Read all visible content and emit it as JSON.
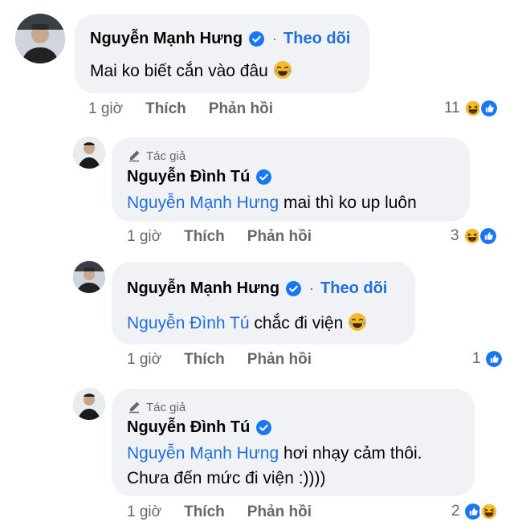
{
  "comments": [
    {
      "author": "Nguyễn Mạnh Hưng",
      "follow": "Theo dõi",
      "text": "Mai ko biết cắn vào đâu",
      "time": "1 giờ",
      "like": "Thích",
      "reply": "Phản hồi",
      "reaction_count": "11",
      "reaction_icons": [
        "haha-icon",
        "like-icon"
      ]
    },
    {
      "badge": "Tác giả",
      "author": "Nguyễn Đình Tú",
      "mention": "Nguyễn Mạnh Hưng",
      "text": "mai thì ko up luôn",
      "time": "1 giờ",
      "like": "Thích",
      "reply": "Phản hồi",
      "reaction_count": "3",
      "reaction_icons": [
        "haha-icon",
        "like-icon"
      ]
    },
    {
      "author": "Nguyễn Mạnh Hưng",
      "follow": "Theo dõi",
      "mention": "Nguyễn Đình Tú",
      "text": "chắc đi viện",
      "time": "1 giờ",
      "like": "Thích",
      "reply": "Phản hồi",
      "reaction_count": "1",
      "reaction_icons": [
        "like-icon"
      ]
    },
    {
      "badge": "Tác giả",
      "author": "Nguyễn Đình Tú",
      "mention": "Nguyễn Mạnh Hưng",
      "text": "hơi nhạy cảm thôi.",
      "text_line2": "Chưa đến mức đi viện :))))",
      "time": "1 giờ",
      "like": "Thích",
      "reply": "Phản hồi",
      "reaction_count": "2",
      "reaction_icons": [
        "like-icon",
        "haha-icon"
      ]
    }
  ],
  "colors": {
    "link": "#216fdb",
    "bubble": "#f0f2f5",
    "muted": "#65676b",
    "like": "#1877f2",
    "haha": "#f7b928"
  }
}
